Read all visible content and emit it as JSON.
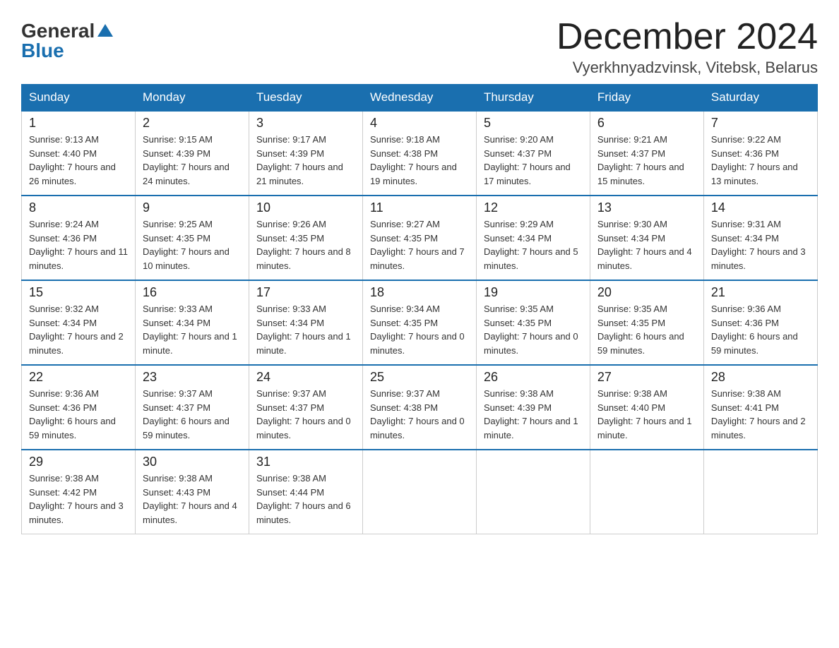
{
  "logo": {
    "general": "General",
    "blue": "Blue"
  },
  "title": {
    "month": "December 2024",
    "location": "Vyerkhnyadzvinsk, Vitebsk, Belarus"
  },
  "weekdays": [
    "Sunday",
    "Monday",
    "Tuesday",
    "Wednesday",
    "Thursday",
    "Friday",
    "Saturday"
  ],
  "weeks": [
    [
      {
        "day": "1",
        "sunrise": "9:13 AM",
        "sunset": "4:40 PM",
        "daylight": "7 hours and 26 minutes."
      },
      {
        "day": "2",
        "sunrise": "9:15 AM",
        "sunset": "4:39 PM",
        "daylight": "7 hours and 24 minutes."
      },
      {
        "day": "3",
        "sunrise": "9:17 AM",
        "sunset": "4:39 PM",
        "daylight": "7 hours and 21 minutes."
      },
      {
        "day": "4",
        "sunrise": "9:18 AM",
        "sunset": "4:38 PM",
        "daylight": "7 hours and 19 minutes."
      },
      {
        "day": "5",
        "sunrise": "9:20 AM",
        "sunset": "4:37 PM",
        "daylight": "7 hours and 17 minutes."
      },
      {
        "day": "6",
        "sunrise": "9:21 AM",
        "sunset": "4:37 PM",
        "daylight": "7 hours and 15 minutes."
      },
      {
        "day": "7",
        "sunrise": "9:22 AM",
        "sunset": "4:36 PM",
        "daylight": "7 hours and 13 minutes."
      }
    ],
    [
      {
        "day": "8",
        "sunrise": "9:24 AM",
        "sunset": "4:36 PM",
        "daylight": "7 hours and 11 minutes."
      },
      {
        "day": "9",
        "sunrise": "9:25 AM",
        "sunset": "4:35 PM",
        "daylight": "7 hours and 10 minutes."
      },
      {
        "day": "10",
        "sunrise": "9:26 AM",
        "sunset": "4:35 PM",
        "daylight": "7 hours and 8 minutes."
      },
      {
        "day": "11",
        "sunrise": "9:27 AM",
        "sunset": "4:35 PM",
        "daylight": "7 hours and 7 minutes."
      },
      {
        "day": "12",
        "sunrise": "9:29 AM",
        "sunset": "4:34 PM",
        "daylight": "7 hours and 5 minutes."
      },
      {
        "day": "13",
        "sunrise": "9:30 AM",
        "sunset": "4:34 PM",
        "daylight": "7 hours and 4 minutes."
      },
      {
        "day": "14",
        "sunrise": "9:31 AM",
        "sunset": "4:34 PM",
        "daylight": "7 hours and 3 minutes."
      }
    ],
    [
      {
        "day": "15",
        "sunrise": "9:32 AM",
        "sunset": "4:34 PM",
        "daylight": "7 hours and 2 minutes."
      },
      {
        "day": "16",
        "sunrise": "9:33 AM",
        "sunset": "4:34 PM",
        "daylight": "7 hours and 1 minute."
      },
      {
        "day": "17",
        "sunrise": "9:33 AM",
        "sunset": "4:34 PM",
        "daylight": "7 hours and 1 minute."
      },
      {
        "day": "18",
        "sunrise": "9:34 AM",
        "sunset": "4:35 PM",
        "daylight": "7 hours and 0 minutes."
      },
      {
        "day": "19",
        "sunrise": "9:35 AM",
        "sunset": "4:35 PM",
        "daylight": "7 hours and 0 minutes."
      },
      {
        "day": "20",
        "sunrise": "9:35 AM",
        "sunset": "4:35 PM",
        "daylight": "6 hours and 59 minutes."
      },
      {
        "day": "21",
        "sunrise": "9:36 AM",
        "sunset": "4:36 PM",
        "daylight": "6 hours and 59 minutes."
      }
    ],
    [
      {
        "day": "22",
        "sunrise": "9:36 AM",
        "sunset": "4:36 PM",
        "daylight": "6 hours and 59 minutes."
      },
      {
        "day": "23",
        "sunrise": "9:37 AM",
        "sunset": "4:37 PM",
        "daylight": "6 hours and 59 minutes."
      },
      {
        "day": "24",
        "sunrise": "9:37 AM",
        "sunset": "4:37 PM",
        "daylight": "7 hours and 0 minutes."
      },
      {
        "day": "25",
        "sunrise": "9:37 AM",
        "sunset": "4:38 PM",
        "daylight": "7 hours and 0 minutes."
      },
      {
        "day": "26",
        "sunrise": "9:38 AM",
        "sunset": "4:39 PM",
        "daylight": "7 hours and 1 minute."
      },
      {
        "day": "27",
        "sunrise": "9:38 AM",
        "sunset": "4:40 PM",
        "daylight": "7 hours and 1 minute."
      },
      {
        "day": "28",
        "sunrise": "9:38 AM",
        "sunset": "4:41 PM",
        "daylight": "7 hours and 2 minutes."
      }
    ],
    [
      {
        "day": "29",
        "sunrise": "9:38 AM",
        "sunset": "4:42 PM",
        "daylight": "7 hours and 3 minutes."
      },
      {
        "day": "30",
        "sunrise": "9:38 AM",
        "sunset": "4:43 PM",
        "daylight": "7 hours and 4 minutes."
      },
      {
        "day": "31",
        "sunrise": "9:38 AM",
        "sunset": "4:44 PM",
        "daylight": "7 hours and 6 minutes."
      },
      null,
      null,
      null,
      null
    ]
  ]
}
